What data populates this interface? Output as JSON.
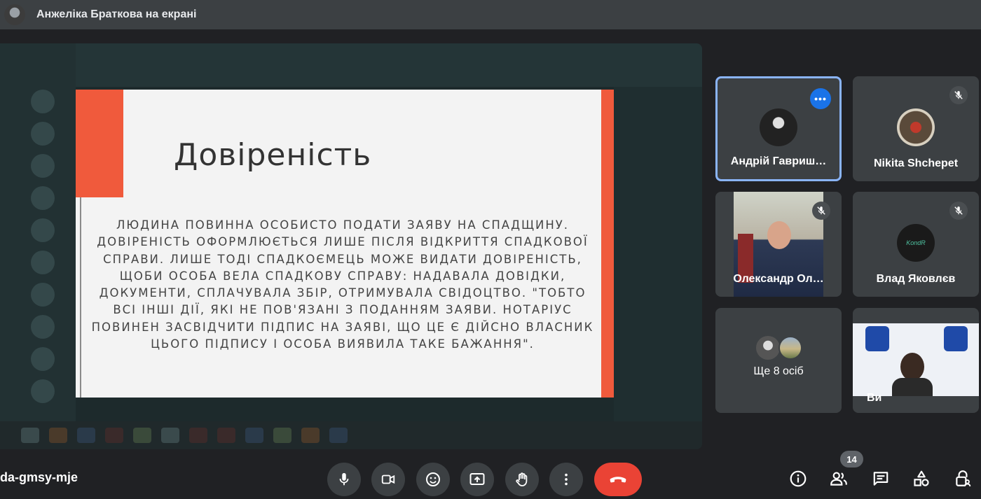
{
  "header": {
    "presenter_title": "Анжеліка Браткова на екрані"
  },
  "slide": {
    "title": "Довіреність",
    "body": "Людина повинна особисто подати заяву на спадщину. Довіреність оформлюється лише після відкриття спадкової справи. Лише тоді спадкоємець може видати довіреність, щоби особа вела спадкову справу: надавала довідки, документи, сплачувала збір, отримувала свідоцтво. \"Тобто всі інші дії, які не пов'язані з поданням заяви. Нотаріус повинен засвідчити підпис на заяві, що це є дійсно власник цього підпису і особа виявила таке бажання\"."
  },
  "participants": [
    {
      "name": "Андрій Гавриш…",
      "muted": false,
      "active": true
    },
    {
      "name": "Nikita Shchepet",
      "muted": true
    },
    {
      "name": "Олександр Ол…",
      "muted": true
    },
    {
      "name": "Влад Яковлєв",
      "muted": true,
      "avatar_text": "KondR"
    },
    {
      "name": "Ще 8 осіб"
    },
    {
      "name": "Ви"
    }
  ],
  "footer": {
    "meeting_code": "da-gmsy-mje",
    "people_count": "14"
  },
  "colors": {
    "accent": "#f05a3c",
    "active_border": "#8ab4f8",
    "hangup": "#ea4335"
  }
}
